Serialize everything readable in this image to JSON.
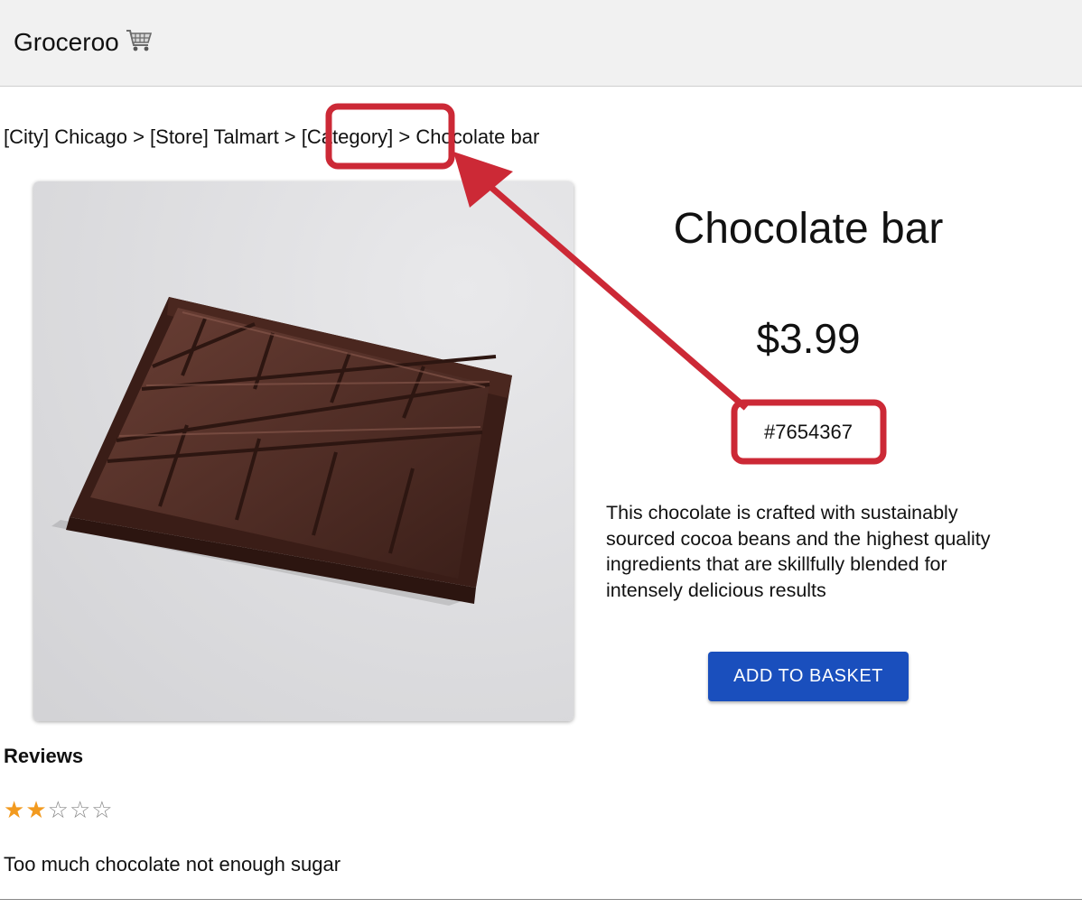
{
  "app": {
    "name": "Groceroo"
  },
  "breadcrumb": {
    "city": "[City] Chicago",
    "sep1": " > ",
    "store": "[Store] Talmart",
    "sep2": " > ",
    "category": "[Category]",
    "sep3": " > ",
    "product": "Chocolate bar"
  },
  "product": {
    "title": "Chocolate bar",
    "price": "$3.99",
    "sku": "#7654367",
    "description": "This chocolate is crafted with sustainably sourced cocoa beans and the highest quality ingredients that are skillfully blended for intensely delicious results",
    "add_label": "ADD TO BASKET"
  },
  "reviews": {
    "heading": "Reviews",
    "rating": 2,
    "max_rating": 5,
    "text": "Too much chocolate not enough sugar"
  },
  "colors": {
    "accent": "#1a4fbd",
    "star": "#f29a1f",
    "annotation": "#cc2936"
  }
}
